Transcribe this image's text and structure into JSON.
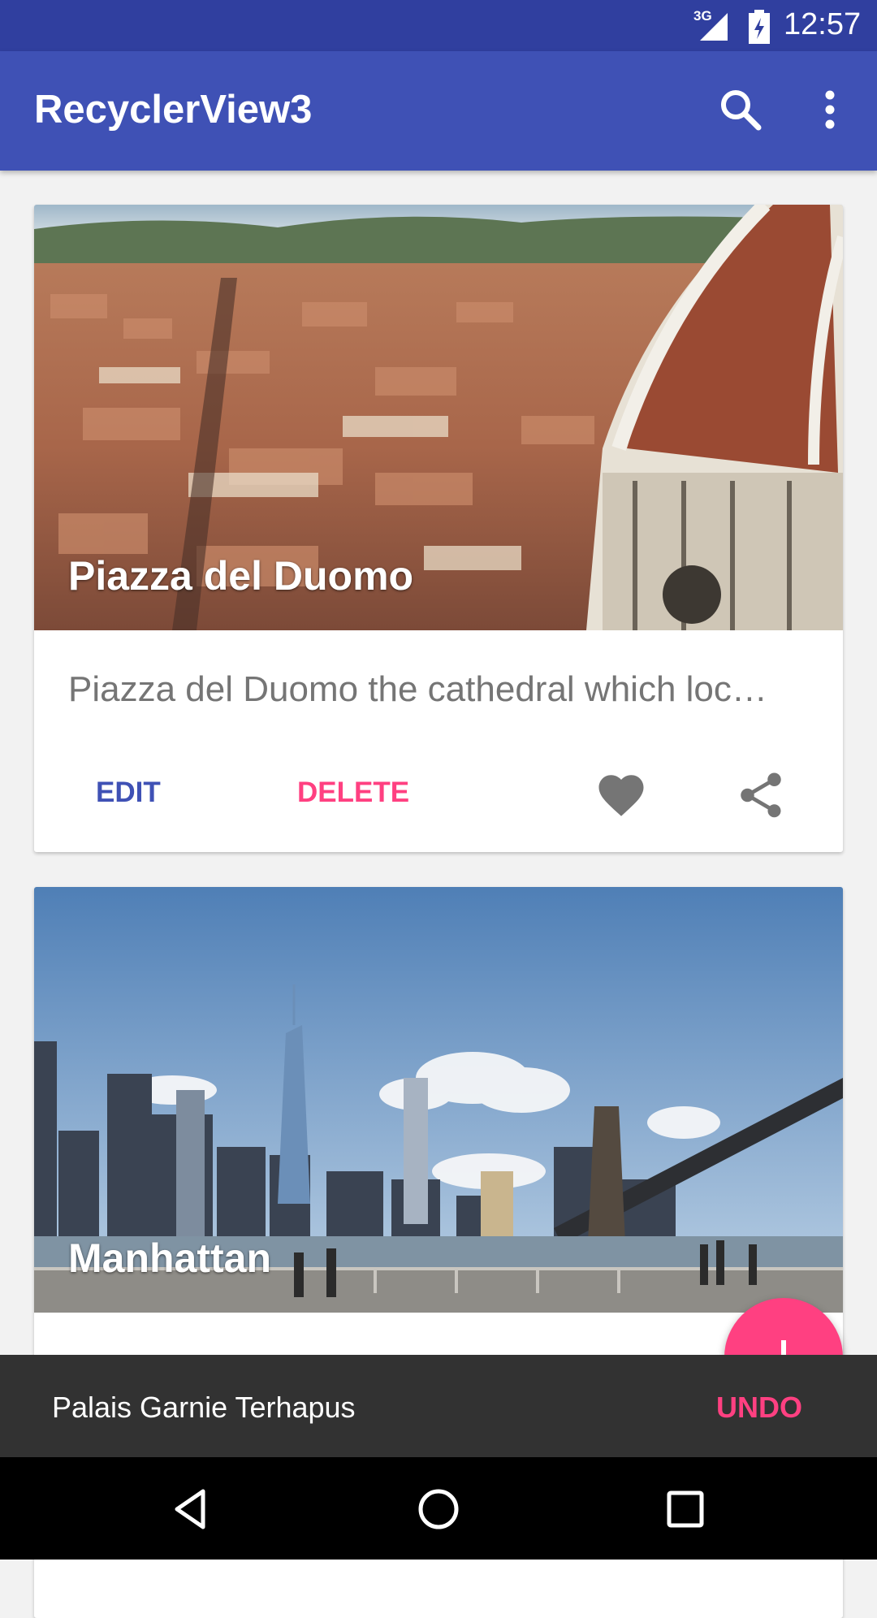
{
  "status_bar": {
    "network": "3G",
    "time": "12:57"
  },
  "app_bar": {
    "title": "RecyclerView3",
    "icons": [
      "search-icon",
      "more-vert-icon"
    ]
  },
  "cards": [
    {
      "title": "Piazza del Duomo",
      "description": "Piazza del Duomo the cathedral which loc…",
      "edit_label": "EDIT",
      "delete_label": "DELETE",
      "icons": [
        "favorite-icon",
        "share-icon"
      ]
    },
    {
      "title": "Manhattan"
    }
  ],
  "fab": {
    "icon": "add-icon"
  },
  "snackbar": {
    "message": "Palais Garnie Terhapus",
    "action_label": "UNDO"
  },
  "colors": {
    "status_bar": "#303f9f",
    "primary": "#3f51b5",
    "accent": "#ff4081",
    "snackbar": "#323232"
  }
}
